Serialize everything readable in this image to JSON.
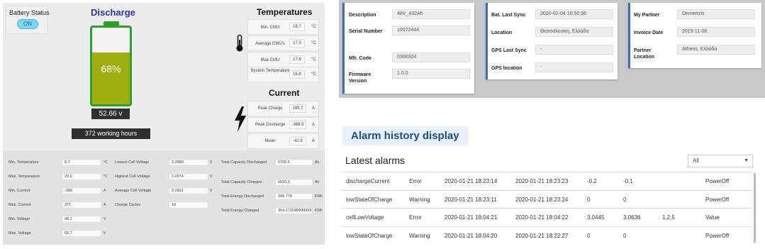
{
  "battery_status": {
    "label": "Battery Status",
    "toggle": "ON"
  },
  "discharge": {
    "title": "Discharge",
    "percent": 0.68,
    "percent_label": "68%",
    "voltage": "52.66 v",
    "hours": "372 working hours"
  },
  "temperatures": {
    "title": "Temperatures",
    "rows": [
      {
        "label": "Min. CMU",
        "value": "16.7",
        "unit": "°C"
      },
      {
        "label": "Average CMU's",
        "value": "17.3",
        "unit": "°C"
      },
      {
        "label": "Max CMU",
        "value": "17.6",
        "unit": "°C"
      },
      {
        "label": "System Temperature",
        "value": "16.8",
        "unit": "°C"
      }
    ]
  },
  "current": {
    "title": "Current",
    "rows": [
      {
        "label": "Peak Charge",
        "value": "285.7",
        "unit": "A"
      },
      {
        "label": "Peak Discharge",
        "value": "-368.9",
        "unit": "A"
      },
      {
        "label": "Mean",
        "value": "-42.6",
        "unit": "A"
      }
    ]
  },
  "stats": {
    "col1": [
      {
        "label": "Min. Temperature",
        "value": "8.7",
        "unit": "°C"
      },
      {
        "label": "Max. Temperature",
        "value": "29.9",
        "unit": "°C"
      },
      {
        "label": "Min. Current",
        "value": "-388",
        "unit": "A"
      },
      {
        "label": "Max. Current",
        "value": "371",
        "unit": "A"
      },
      {
        "label": "Min. Voltage",
        "value": "48.1",
        "unit": "V"
      },
      {
        "label": "Max. Voltage",
        "value": "55.7",
        "unit": "V"
      }
    ],
    "col2": [
      {
        "label": "Lowest Cell Voltage",
        "value": "3.2889",
        "unit": "V"
      },
      {
        "label": "Highest Cell Voltage",
        "value": "3.2974",
        "unit": "V"
      },
      {
        "label": "Average Cell Voltage",
        "value": "3.2931",
        "unit": "V"
      },
      {
        "label": "Charge Cycles",
        "value": "19",
        "unit": ""
      }
    ],
    "col3": [
      {
        "label": "Total Capacity Discharged",
        "value": "6700.6",
        "unit": "Ah"
      },
      {
        "label": "Total Capacity Charged",
        "value": "6693.3",
        "unit": "Ah"
      },
      {
        "label": "Total Energy Discharged",
        "value": "346.778",
        "unit": "KWh"
      },
      {
        "label": "Total Energy Charged",
        "value": "364.272099999999",
        "unit": "KWh"
      }
    ]
  },
  "card1": [
    {
      "label": "Description",
      "value": "48V_432Ah"
    },
    {
      "label": "Serial Number",
      "value": "10072444"
    },
    {
      "label": "Mfr. Code",
      "value": "0306924"
    },
    {
      "label": "Firmware Version",
      "value": "1.0.0"
    }
  ],
  "card2": [
    {
      "label": "Bat. Last Sync",
      "value": "2020-02-04 10:50:36"
    },
    {
      "label": "Location",
      "value": "Θεσσαλονίκη, Ελλάδα"
    },
    {
      "label": "GPS Last Sync",
      "value": "-"
    },
    {
      "label": "GPS location",
      "value": "-"
    }
  ],
  "card3": [
    {
      "label": "My Partner",
      "value": "Demertzis"
    },
    {
      "label": "Invoice Date",
      "value": "2019-11-08"
    },
    {
      "label": "Partner Location",
      "value": "Athens, Ελλάδα"
    }
  ],
  "alarm_button": "Alarm history display",
  "latest_alarms": {
    "title": "Latest alarms",
    "filter": "All",
    "rows": [
      {
        "name": "dischargeCurrent",
        "level": "Error",
        "start": "2020-01-21 18:23:14",
        "end": "2020-01-21 18:23:23",
        "v1": "-0.2",
        "v2": "-0.1",
        "v3": "",
        "action": "PowerOff"
      },
      {
        "name": "lowStateOfCharge",
        "level": "Warning",
        "start": "2020-01-21 18:23:11",
        "end": "2020-01-21 18:23:24",
        "v1": "0",
        "v2": "0",
        "v3": "",
        "action": "PowerOff"
      },
      {
        "name": "cellLowVoltage",
        "level": "Error",
        "start": "2020-01-21 18:04:21",
        "end": "2020-01-21 18:04:22",
        "v1": "3.0445",
        "v2": "3.0636",
        "v3": "1,2,5",
        "action": "Value"
      },
      {
        "name": "lowStateOfCharge",
        "level": "Warning",
        "start": "2020-01-21 18:04:20",
        "end": "2020-01-21 18:22:27",
        "v1": "0",
        "v2": "0",
        "v3": "",
        "action": "PowerOff"
      }
    ]
  }
}
